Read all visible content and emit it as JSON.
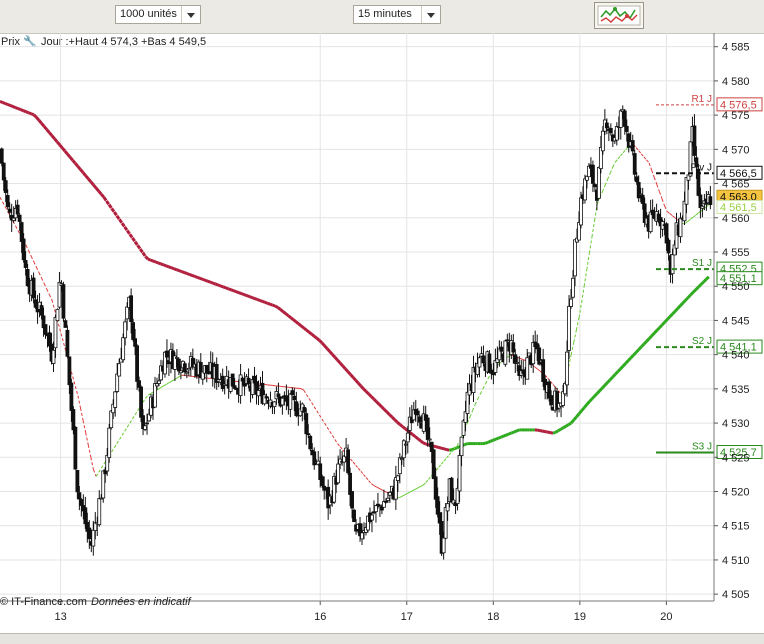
{
  "toolbar": {
    "units_select": "1000 unités",
    "period_select": "15 minutes",
    "indicator_button": "indicators-chart-icon"
  },
  "info": {
    "prix_label": "Prix",
    "day_summary": "Jour :+Haut 4 574,3 +Bas 4 549,5"
  },
  "footer": {
    "source": "© IT-Finance.com",
    "note": "Données en indicatif"
  },
  "colors": {
    "ma_slow": "#b01e3c",
    "ma_up": "#2eaa1e",
    "ma_fast_down": "#e03a3a",
    "ma_fast_up": "#66cc33",
    "candle": "#111111",
    "pivot": "#111111",
    "r1": "#d04040",
    "s_levels": "#2a8a1e"
  },
  "chart_data": {
    "type": "line",
    "title": "",
    "xlabel": "",
    "ylabel": "",
    "xlim": [
      12.3,
      20.55
    ],
    "ylim": [
      4504,
      4587
    ],
    "x_ticks": [
      13,
      16,
      17,
      18,
      19,
      20
    ],
    "x_tick_labels": [
      "13",
      "16",
      "17",
      "18",
      "19",
      "20"
    ],
    "y_ticks": [
      4505,
      4510,
      4515,
      4520,
      4525,
      4530,
      4535,
      4540,
      4545,
      4550,
      4555,
      4560,
      4565,
      4570,
      4575,
      4580,
      4585
    ],
    "y_tick_labels": [
      "4 505",
      "4 510",
      "4 515",
      "4 520",
      "4 525",
      "4 530",
      "4 535",
      "4 540",
      "4 545",
      "4 550",
      "4 555",
      "4 560",
      "4 565",
      "4 570",
      "4 575",
      "4 580",
      "4 585"
    ],
    "price_series": {
      "x": [
        12.3,
        12.4,
        12.5,
        12.6,
        12.7,
        12.8,
        12.9,
        13.0,
        13.1,
        13.2,
        13.35,
        13.5,
        13.65,
        13.8,
        13.95,
        14.2,
        15.8,
        15.9,
        16.0,
        16.1,
        16.2,
        16.3,
        16.4,
        16.55,
        16.7,
        16.85,
        17.0,
        17.1,
        17.2,
        17.3,
        17.4,
        17.5,
        17.55,
        17.7,
        17.85,
        18.0,
        18.1,
        18.2,
        18.3,
        18.4,
        18.5,
        18.65,
        18.8,
        18.9,
        19.0,
        19.1,
        19.2,
        19.3,
        19.4,
        19.5,
        19.6,
        19.7,
        19.8,
        19.9,
        20.0,
        20.05,
        20.1,
        20.2,
        20.3,
        20.4,
        20.5
      ],
      "y": [
        4570,
        4560,
        4562,
        4552,
        4548,
        4545,
        4540,
        4552,
        4536,
        4520,
        4512,
        4522,
        4537,
        4548,
        4528,
        4540,
        4532,
        4526,
        4522,
        4518,
        4523,
        4525,
        4513,
        4516,
        4518,
        4520,
        4528,
        4533,
        4530,
        4524,
        4512,
        4521,
        4517,
        4534,
        4540,
        4538,
        4540,
        4542,
        4536,
        4539,
        4541,
        4534,
        4532,
        4550,
        4562,
        4567,
        4564,
        4575,
        4571,
        4576,
        4569,
        4562,
        4559,
        4561,
        4558,
        4551,
        4557,
        4561,
        4572,
        4560,
        4563
      ]
    },
    "series": [
      {
        "name": "",
        "x": [
          12.3,
          12.7,
          13.1,
          13.5,
          14.0,
          15.5,
          16.0,
          16.5,
          16.9,
          17.2,
          17.5,
          17.7,
          17.9,
          18.1,
          18.3,
          18.5,
          18.7,
          18.9,
          19.1,
          19.4,
          19.7,
          20.0,
          20.3,
          20.5
        ],
        "y": [
          4577,
          4575,
          4569,
          4563,
          4554,
          4547,
          4542,
          4535,
          4530,
          4527,
          4526,
          4527,
          4527,
          4528,
          4529,
          4529,
          4528.5,
          4530,
          4533,
          4537,
          4541,
          4545,
          4549,
          4551.5
        ]
      },
      {
        "name": "",
        "x": [
          12.3,
          12.6,
          12.9,
          13.2,
          13.4,
          13.7,
          14.0,
          14.4,
          15.8,
          16.2,
          16.6,
          16.9,
          17.2,
          17.4,
          17.6,
          17.8,
          18.0,
          18.2,
          18.4,
          18.6,
          18.8,
          19.0,
          19.2,
          19.4,
          19.6,
          19.8,
          20.0,
          20.2,
          20.4,
          20.5
        ],
        "y": [
          4563,
          4556,
          4548,
          4534,
          4522,
          4528,
          4534,
          4537,
          4535,
          4527,
          4521,
          4519,
          4521,
          4524,
          4527,
          4533,
          4538,
          4540,
          4539,
          4537,
          4534,
          4546,
          4562,
          4568,
          4571,
          4568,
          4561,
          4559,
          4561,
          4562
        ]
      }
    ],
    "levels": [
      {
        "label": "R1 J",
        "value": 4576.5,
        "value_label": "4 576,5"
      },
      {
        "label": "Piv J",
        "value": 4566.5,
        "value_label": "4 566,5"
      },
      {
        "label": "",
        "value": 4563.0,
        "value_label": "4 563,0"
      },
      {
        "label": "",
        "value": 4561.5,
        "value_label": "4 561,5"
      },
      {
        "label": "S1 J",
        "value": 4552.5,
        "value_label": "4 552,5"
      },
      {
        "label": "",
        "value": 4551.1,
        "value_label": "4 551,1"
      },
      {
        "label": "S2 J",
        "value": 4541.1,
        "value_label": "4 541,1"
      },
      {
        "label": "S3 J",
        "value": 4525.7,
        "value_label": "4 525,7"
      }
    ]
  }
}
